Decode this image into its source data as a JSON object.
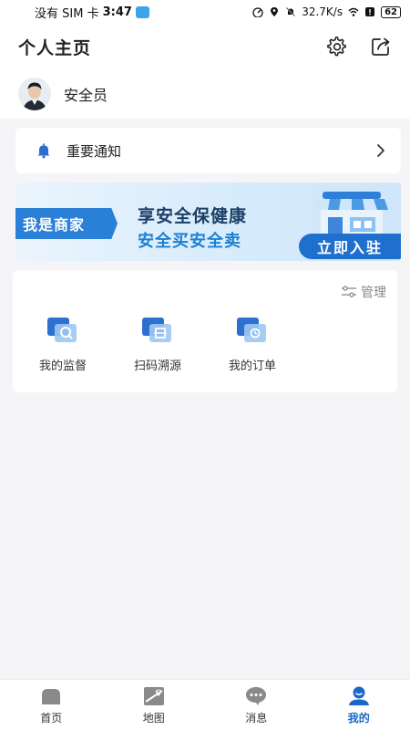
{
  "status_bar": {
    "carrier": "没有 SIM 卡",
    "time": "3:47",
    "speed": "32.7K/s",
    "battery": "62"
  },
  "header": {
    "title": "个人主页",
    "icons": [
      "gear-icon",
      "share-icon"
    ]
  },
  "profile": {
    "name": "安全员"
  },
  "notice": {
    "label": "重要通知",
    "icon": "bell-icon"
  },
  "banner": {
    "tag": "我是商家",
    "line1": "享安全保健康",
    "line2": "安全买安全卖",
    "cta": "立即入驻"
  },
  "functions": {
    "manage_label": "管理",
    "items": [
      {
        "label": "我的监督",
        "icon": "supervision-icon"
      },
      {
        "label": "扫码溯源",
        "icon": "scan-trace-icon"
      },
      {
        "label": "我的订单",
        "icon": "order-icon"
      }
    ]
  },
  "bottom_nav": {
    "items": [
      {
        "label": "首页",
        "icon": "home-icon"
      },
      {
        "label": "地图",
        "icon": "map-icon"
      },
      {
        "label": "消息",
        "icon": "message-icon"
      },
      {
        "label": "我的",
        "icon": "profile-icon",
        "active": true
      }
    ]
  },
  "colors": {
    "accent": "#1a67c8",
    "banner_blue": "#2a7fd6",
    "background": "#f5f5f7"
  }
}
